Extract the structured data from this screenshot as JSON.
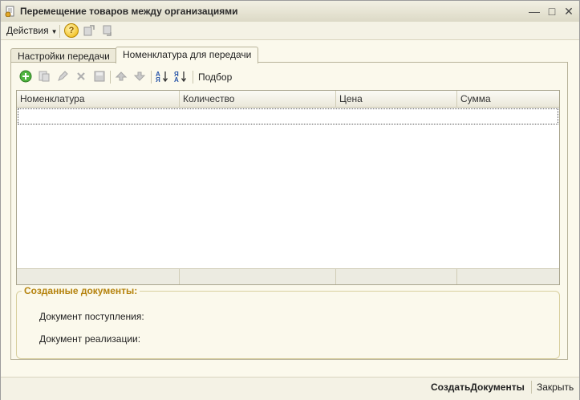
{
  "window": {
    "title": "Перемещение товаров между организациями"
  },
  "cmdbar": {
    "actions_label": "Действия",
    "help_label": "?"
  },
  "tabs": [
    {
      "label": "Настройки передачи",
      "active": false
    },
    {
      "label": "Номенклатура для передачи",
      "active": true
    }
  ],
  "toolbar": {
    "podbor_label": "Подбор",
    "icons": [
      "add-icon",
      "copy-icon",
      "edit-icon",
      "delete-icon",
      "save-icon",
      "move-up-icon",
      "move-down-icon",
      "sort-asc-icon",
      "sort-desc-icon"
    ]
  },
  "table": {
    "columns": [
      "Номенклатура",
      "Количество",
      "Цена",
      "Сумма"
    ]
  },
  "created_docs": {
    "title": "Созданные документы:",
    "receipt_label": "Документ поступления:",
    "sale_label": "Документ реализации:"
  },
  "bottombar": {
    "create_label": "СоздатьДокументы",
    "close_label": "Закрыть"
  },
  "colors": {
    "group_title": "#b5830e",
    "accent_green": "#3a9a2a"
  }
}
